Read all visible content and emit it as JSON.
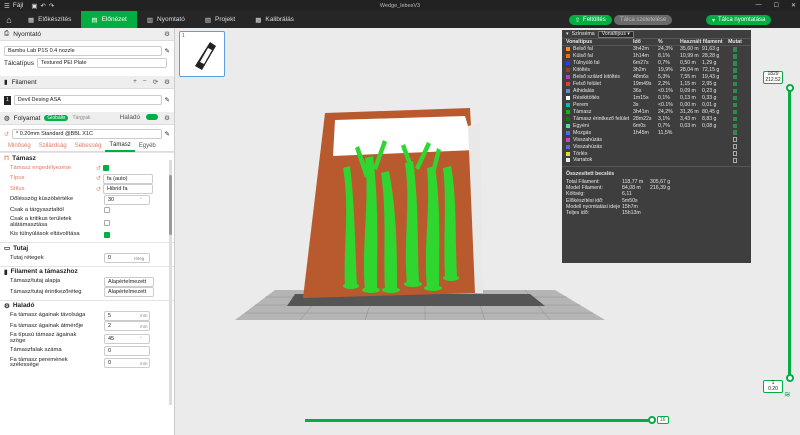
{
  "titlebar": {
    "menu_label": "Fájl",
    "window_title": "Wedge_lebesV3"
  },
  "tabs": [
    {
      "label": "Előkészítés"
    },
    {
      "label": "Előnézet"
    },
    {
      "label": "Nyomtató"
    },
    {
      "label": "Projekt"
    },
    {
      "label": "Kalibrálás"
    }
  ],
  "actions": {
    "upload": "Feltöltés",
    "plate_upload": "Tálca szeletelése",
    "print_plate": "Tálca nyomtatása"
  },
  "printer": {
    "section_title": "Nyomtató",
    "printer_name": "Bambu Lab P1S 0.4 nozzle",
    "plate_label": "Tálcatípus",
    "plate_value": "Textured PEI Plate"
  },
  "filament": {
    "section_title": "Filament",
    "item_index": "1",
    "item_name": "Devil Desing ASA"
  },
  "process": {
    "section_title": "Folyamat",
    "toggle_global": "Globális",
    "toggle_object": "Tárgyak",
    "advanced_label": "Haladó",
    "profile": "* 0.20mm Standard @BBL X1C",
    "tabs": [
      "Minőség",
      "Szilárdság",
      "Sebesség",
      "Támasz",
      "Egyéb"
    ],
    "active_tab": "Támasz"
  },
  "support": {
    "group_title": "Támasz",
    "rows": [
      {
        "label": "Támasz engedélyezése",
        "orange": true,
        "type": "check",
        "checked": true
      },
      {
        "label": "Típus",
        "orange": true,
        "type": "select",
        "value": "fa (auto)"
      },
      {
        "label": "Stílus",
        "orange": true,
        "type": "select",
        "value": "Hibrid fa"
      },
      {
        "label": "Dőlésszög küszöbértéke",
        "orange": false,
        "type": "spin",
        "value": "30",
        "unit": "°"
      },
      {
        "label": "Csak a tárgyasztaltól",
        "orange": false,
        "type": "check",
        "checked": false
      },
      {
        "label": "Csak a kritikus területek alátámasztása",
        "orange": false,
        "type": "check",
        "checked": false
      },
      {
        "label": "Kis túlnyúlások eltávolítása",
        "orange": false,
        "type": "check",
        "checked": true
      }
    ]
  },
  "raft": {
    "group_title": "Tutaj",
    "layers_label": "Tutaj rétegek",
    "layers_value": "0",
    "layers_unit": "réteg"
  },
  "filament_support": {
    "group_title": "Filament a támaszhoz",
    "base_label": "Támasz/tutaj alapja",
    "base_value": "Alapértelmezett",
    "interface_label": "Támasz/tutaj érintkezőréteg",
    "interface_value": "Alapértelmezett"
  },
  "advanced": {
    "group_title": "Haladó",
    "rows": [
      {
        "label": "Fa támasz ágainak távolsága",
        "value": "5",
        "unit": "mm"
      },
      {
        "label": "Fa támasz ágainak átmérője",
        "value": "2",
        "unit": "mm"
      },
      {
        "label": "Fa típusú támasz ágainak szöge",
        "value": "45",
        "unit": "°"
      },
      {
        "label": "Támaszfalak száma",
        "value": "0",
        "unit": ""
      },
      {
        "label": "Fa támasz peremének szélessége",
        "value": "0",
        "unit": "mm"
      }
    ]
  },
  "legend": {
    "scheme_label": "Színséma",
    "scheme_value": "Vonaltípus",
    "headers": [
      "Vonaltípus",
      "Idő",
      "%",
      "Használt filament",
      "Mutat"
    ],
    "rows": [
      {
        "name": "Belső fal",
        "color": "#ff8c1a",
        "time": "3h42m",
        "pct": "24,3%",
        "len": "35,60 m",
        "weight": "91,63 g",
        "show": true
      },
      {
        "name": "Külső fal",
        "color": "#ff6a00",
        "time": "1h14m",
        "pct": "8,1%",
        "len": "10,99 m",
        "weight": "28,28 g",
        "show": true
      },
      {
        "name": "Túlnyúló fal",
        "color": "#1f3fff",
        "time": "6m27s",
        "pct": "0,7%",
        "len": "0,50 m",
        "weight": "1,29 g",
        "show": true
      },
      {
        "name": "Kitöltés",
        "color": "#a83232",
        "time": "3h2m",
        "pct": "19,9%",
        "len": "28,04 m",
        "weight": "72,15 g",
        "show": true
      },
      {
        "name": "Belső szilárd kitöltés",
        "color": "#b040c0",
        "time": "48m6s",
        "pct": "5,3%",
        "len": "7,55 m",
        "weight": "19,43 g",
        "show": true
      },
      {
        "name": "Felső felület",
        "color": "#e43d3d",
        "time": "19m49s",
        "pct": "2,2%",
        "len": "1,15 m",
        "weight": "2,95 g",
        "show": true
      },
      {
        "name": "Áthidalás",
        "color": "#5a8fd8",
        "time": "36s",
        "pct": "<0.1%",
        "len": "0,09 m",
        "weight": "0,23 g",
        "show": true
      },
      {
        "name": "Résikitöltés",
        "color": "#ffffff",
        "time": "1m15s",
        "pct": "0,1%",
        "len": "0,13 m",
        "weight": "0,33 g",
        "show": true
      },
      {
        "name": "Perem",
        "color": "#00c0a0",
        "time": "3s",
        "pct": "<0.1%",
        "len": "0,00 m",
        "weight": "0,01 g",
        "show": true
      },
      {
        "name": "Támasz",
        "color": "#00c000",
        "time": "3h41m",
        "pct": "24,2%",
        "len": "31,26 m",
        "weight": "80,45 g",
        "show": true
      },
      {
        "name": "Támasz érintkező felület",
        "color": "#008000",
        "time": "28m22s",
        "pct": "3,1%",
        "len": "3,43 m",
        "weight": "8,83 g",
        "show": true
      },
      {
        "name": "Egyéni",
        "color": "#5ed8a0",
        "time": "6m0s",
        "pct": "0,7%",
        "len": "0,03 m",
        "weight": "0,08 g",
        "show": true
      },
      {
        "name": "Mozgás",
        "color": "#4a6fe0",
        "time": "1h45m",
        "pct": "11,5%",
        "len": "",
        "weight": "",
        "show": true
      },
      {
        "name": "Visszahúzás",
        "color": "#d040d0",
        "time": "",
        "pct": "",
        "len": "",
        "weight": "",
        "show": false
      },
      {
        "name": "Visszahúzás",
        "color": "#6060e0",
        "time": "",
        "pct": "",
        "len": "",
        "weight": "",
        "show": false
      },
      {
        "name": "Törlés",
        "color": "#e0e020",
        "time": "",
        "pct": "",
        "len": "",
        "weight": "",
        "show": false
      },
      {
        "name": "Varratok",
        "color": "#eeeeee",
        "time": "",
        "pct": "",
        "len": "",
        "weight": "",
        "show": false
      }
    ],
    "summary_title": "Összesített becslés",
    "summary": [
      {
        "k": "Total Filament:",
        "v1": "118,77 m",
        "v2": "305,67 g"
      },
      {
        "k": "Model Filament:",
        "v1": "84,08 m",
        "v2": "216,39 g"
      },
      {
        "k": "Költség:",
        "v1": "6,11",
        "v2": ""
      },
      {
        "k": "Előkészítési idő:",
        "v1": "5m50s",
        "v2": ""
      },
      {
        "k": "Modell nyomtatási ideje",
        "v1": "15h7m",
        "v2": ""
      },
      {
        "k": "Teljes idő:",
        "v1": "15h13m",
        "v2": ""
      }
    ]
  },
  "layer_slider": {
    "top_layer": "1829",
    "top_height": "212.52",
    "bottom_layer": "1",
    "bottom_height": "0.20"
  },
  "move_slider": {
    "value": "16"
  },
  "plate_number": "1",
  "colors": {
    "accent": "#00ae42",
    "model": "#b85a2e",
    "support": "#2fd62f"
  }
}
